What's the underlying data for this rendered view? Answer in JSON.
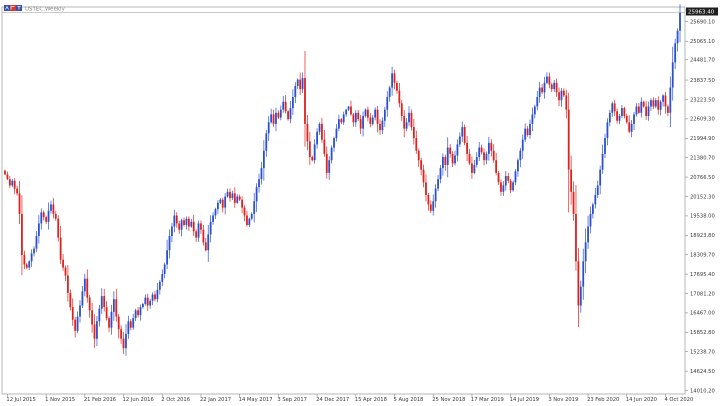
{
  "header": {
    "symbol_title": "USTEC,Weekly"
  },
  "colors": {
    "bull": "#2a4fd1",
    "bear": "#e0201c",
    "grid": "#888888",
    "background": "#ffffff",
    "tag_bg": "#1f1f1f"
  },
  "icons": {
    "logo": "mt-chart-logo-icon"
  },
  "chart_data": {
    "type": "candlestick",
    "title": "USTEC,Weekly",
    "current_price": "25963.40",
    "ylim": [
      13900,
      26150
    ],
    "y_ticks": [
      {
        "value": 25690.0,
        "label": "25690.10"
      },
      {
        "value": 25065.0,
        "label": "25065.10"
      },
      {
        "value": 24481.0,
        "label": "24481.70"
      },
      {
        "value": 23837.5,
        "label": "23837.50"
      },
      {
        "value": 23223.5,
        "label": "23223.50"
      },
      {
        "value": 22609.0,
        "label": "22609.30"
      },
      {
        "value": 21994.9,
        "label": "21994.90"
      },
      {
        "value": 21380.7,
        "label": "21380.70"
      },
      {
        "value": 20766.5,
        "label": "20766.50"
      },
      {
        "value": 20152.3,
        "label": "20152.30"
      },
      {
        "value": 19538.0,
        "label": "19538.00"
      },
      {
        "value": 18923.8,
        "label": "18923.80"
      },
      {
        "value": 18309.7,
        "label": "18309.70"
      },
      {
        "value": 17695.4,
        "label": "17695.40"
      },
      {
        "value": 17081.2,
        "label": "17081.20"
      },
      {
        "value": 16467.0,
        "label": "16467.00"
      },
      {
        "value": 15852.8,
        "label": "15852.80"
      },
      {
        "value": 15238.7,
        "label": "15238.70"
      },
      {
        "value": 14624.5,
        "label": "14624.50"
      },
      {
        "value": 14010.2,
        "label": "14010.20"
      }
    ],
    "x_ticks": [
      {
        "index": 1,
        "label": "12 Jul 2015"
      },
      {
        "index": 17,
        "label": "1 Nov 2015"
      },
      {
        "index": 33,
        "label": "21 Feb 2016"
      },
      {
        "index": 49,
        "label": "12 Jun 2016"
      },
      {
        "index": 65,
        "label": "2 Oct 2016"
      },
      {
        "index": 81,
        "label": "22 Jan 2017"
      },
      {
        "index": 97,
        "label": "14 May 2017"
      },
      {
        "index": 113,
        "label": "3 Sep 2017"
      },
      {
        "index": 129,
        "label": "24 Dec 2017"
      },
      {
        "index": 145,
        "label": "15 Apr 2018"
      },
      {
        "index": 161,
        "label": "5 Aug 2018"
      },
      {
        "index": 177,
        "label": "25 Nov 2018"
      },
      {
        "index": 193,
        "label": "17 Mar 2019"
      },
      {
        "index": 209,
        "label": "14 Jul 2019"
      },
      {
        "index": 225,
        "label": "3 Nov 2019"
      },
      {
        "index": 241,
        "label": "23 Feb 2020"
      },
      {
        "index": 257,
        "label": "14 Jun 2020"
      },
      {
        "index": 273,
        "label": "4 Oct 2020"
      }
    ],
    "closes": [
      20850,
      20700,
      20500,
      20650,
      20400,
      20250,
      19600,
      18300,
      18000,
      17900,
      18100,
      18350,
      18500,
      18900,
      19300,
      19650,
      19500,
      19350,
      19700,
      19900,
      19600,
      19450,
      18850,
      18150,
      17900,
      17650,
      17100,
      16650,
      16250,
      15900,
      16350,
      16700,
      17150,
      17550,
      16950,
      16550,
      16100,
      15650,
      16200,
      16600,
      17000,
      16650,
      16300,
      16000,
      16500,
      16900,
      16350,
      15950,
      15650,
      15350,
      15800,
      16200,
      16000,
      16300,
      16550,
      16400,
      16650,
      16750,
      16950,
      16700,
      16850,
      17050,
      16900,
      17200,
      17450,
      17700,
      18000,
      18450,
      18900,
      19200,
      19550,
      19300,
      19100,
      19400,
      19250,
      19450,
      19200,
      19350,
      19050,
      18850,
      19300,
      19100,
      18700,
      18450,
      18950,
      19350,
      19550,
      19750,
      19950,
      20050,
      19800,
      20150,
      20300,
      20100,
      20250,
      19950,
      20150,
      20050,
      19800,
      19550,
      19250,
      19450,
      19600,
      20000,
      20450,
      20700,
      21050,
      21600,
      22150,
      22500,
      22750,
      22450,
      22800,
      22650,
      22900,
      23150,
      22850,
      22600,
      22950,
      23300,
      23650,
      23850,
      23550,
      23900,
      22450,
      21900,
      21400,
      21300,
      21800,
      22200,
      22450,
      21950,
      21500,
      20900,
      21300,
      21700,
      22000,
      22300,
      22600,
      22500,
      22750,
      22900,
      23000,
      22750,
      22500,
      22800,
      22600,
      22300,
      22700,
      22900,
      22650,
      22450,
      22650,
      22900,
      22450,
      22250,
      22550,
      22900,
      23300,
      23600,
      24050,
      23750,
      23500,
      23100,
      22700,
      22300,
      22500,
      22800,
      22350,
      22000,
      21600,
      21300,
      21000,
      20600,
      20200,
      19900,
      19700,
      20000,
      20400,
      20700,
      21050,
      21400,
      21150,
      21700,
      21500,
      21200,
      21450,
      21800,
      22050,
      22350,
      21850,
      21500,
      21200,
      20900,
      21150,
      21400,
      21700,
      21550,
      21300,
      21500,
      21850,
      21600,
      21300,
      20900,
      20600,
      20300,
      20500,
      20800,
      20650,
      20350,
      20600,
      20950,
      21300,
      21600,
      21950,
      22300,
      22100,
      22450,
      22750,
      23000,
      23300,
      23600,
      23450,
      23750,
      23950,
      23700,
      23550,
      23750,
      23450,
      23200,
      23500,
      23350,
      22900,
      21000,
      20300,
      19600,
      18100,
      16700,
      17300,
      18100,
      18700,
      19200,
      19600,
      19900,
      20200,
      20500,
      21000,
      21500,
      22000,
      22500,
      22800,
      23100,
      22850,
      22550,
      22700,
      22950,
      22700,
      22500,
      22200,
      22450,
      22750,
      23000,
      22800,
      23150,
      23000,
      22700,
      23000,
      23200,
      23000,
      23200,
      22900,
      23150,
      23350,
      23000,
      22800,
      23600,
      24400,
      25000,
      25400,
      25963
    ]
  }
}
